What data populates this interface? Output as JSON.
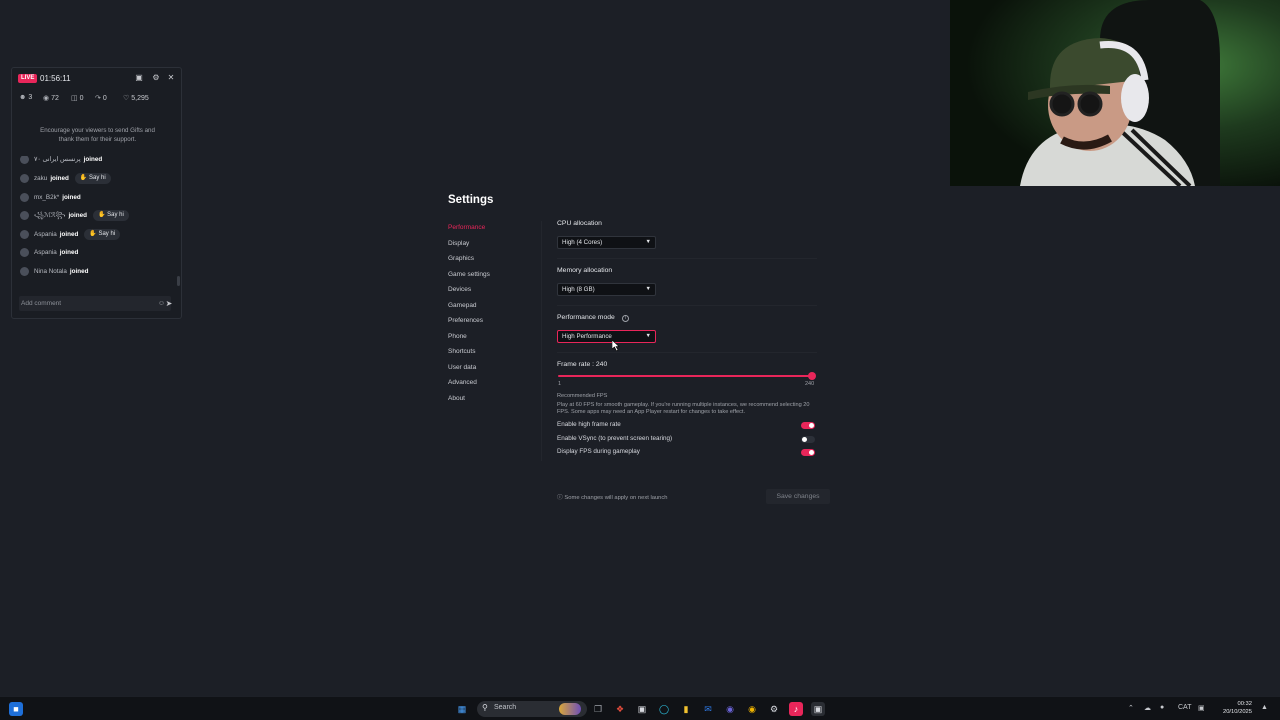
{
  "live_panel": {
    "badge": "LIVE",
    "timer": "01:56:11",
    "stats": [
      {
        "icon": "users-icon",
        "value": "3"
      },
      {
        "icon": "eye-icon",
        "value": "72"
      },
      {
        "icon": "gift-icon",
        "value": "0"
      },
      {
        "icon": "share-icon",
        "value": "0"
      },
      {
        "icon": "heart-icon",
        "value": "5,295"
      }
    ],
    "encourage_line1": "Encourage your viewers to send Gifts and",
    "encourage_line2": "thank them for their support.",
    "chat": [
      {
        "name": "پرنسس ایرانی ۷۰",
        "joined": "joined",
        "say_hi": ""
      },
      {
        "name": "zaku",
        "joined": "joined",
        "say_hi": "Say hi"
      },
      {
        "name": "mx_B2k*",
        "joined": "joined",
        "say_hi": ""
      },
      {
        "name": "꧁ℳℛ꧂",
        "joined": "joined",
        "say_hi": "Say hi"
      },
      {
        "name": "Aspania",
        "joined": "joined",
        "say_hi": "Say hi"
      },
      {
        "name": "Aspania",
        "joined": "joined",
        "say_hi": ""
      },
      {
        "name": "Nina Notala",
        "joined": "joined",
        "say_hi": ""
      }
    ],
    "comment_placeholder": "Add comment"
  },
  "settings": {
    "title": "Settings",
    "nav": [
      "Performance",
      "Display",
      "Graphics",
      "Game settings",
      "Devices",
      "Gamepad",
      "Preferences",
      "Phone",
      "Shortcuts",
      "User data",
      "Advanced",
      "About"
    ],
    "active_nav": "Performance",
    "cpu_label": "CPU allocation",
    "cpu_value": "High (4 Cores)",
    "memory_label": "Memory allocation",
    "memory_value": "High (8 GB)",
    "perf_mode_label": "Performance mode",
    "perf_mode_value": "High Performance",
    "frame_rate_label": "Frame rate : 240",
    "frame_rate": {
      "min": "1",
      "max": "240",
      "value": 240
    },
    "recommended_title": "Recommended FPS",
    "recommended_text": "Play at 60 FPS for smooth gameplay. If you're running multiple instances, we recommend selecting 20 FPS. Some apps may need an App Player restart for changes to take effect.",
    "toggles": [
      {
        "label": "Enable high frame rate",
        "on": true
      },
      {
        "label": "Enable VSync (to prevent screen tearing)",
        "on": false
      },
      {
        "label": "Display FPS during gameplay",
        "on": true
      }
    ],
    "footnote": "ⓘ Some changes will apply on next launch",
    "save_label": "Save changes"
  },
  "taskbar": {
    "search_label": "Search",
    "tray_lang": "CAT",
    "time": "00:32",
    "date": "20/10/2025"
  },
  "colors": {
    "accent": "#e8265a",
    "background": "#1c1f26"
  }
}
